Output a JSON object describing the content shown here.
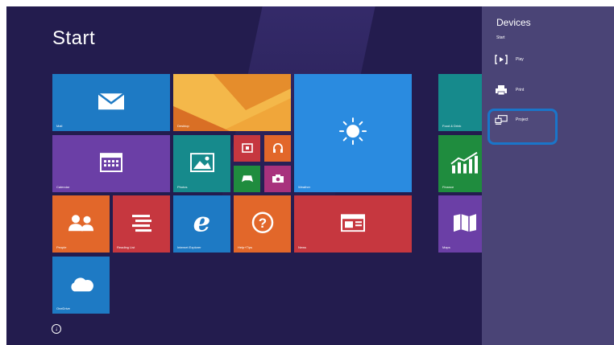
{
  "start": {
    "title": "Start"
  },
  "tiles": {
    "mail": "Mail",
    "desktop": "Desktop",
    "weather": "Weather",
    "calendar": "Calendar",
    "photos": "Photos",
    "people": "People",
    "reading_list": "Reading List",
    "internet_explorer": "Internet Explorer",
    "help_tips": "Help+Tips",
    "news": "News",
    "onedrive": "OneDrive",
    "food_drink": "Food & Drink",
    "finance": "Finance",
    "maps": "Maps"
  },
  "charm": {
    "title": "Devices",
    "subtitle": "Start",
    "items": [
      {
        "label": "Play",
        "icon": "play-icon"
      },
      {
        "label": "Print",
        "icon": "printer-icon"
      },
      {
        "label": "Project",
        "icon": "project-icon"
      }
    ]
  },
  "colors": {
    "background": "#231c4e",
    "charm": "#4a4476",
    "highlight": "#1a75c9",
    "blue": "#1e7ac4",
    "orange": "#e2672a",
    "red": "#c6373f",
    "teal": "#168a8c",
    "green": "#1f8c3e",
    "purple": "#6b3fa6"
  }
}
